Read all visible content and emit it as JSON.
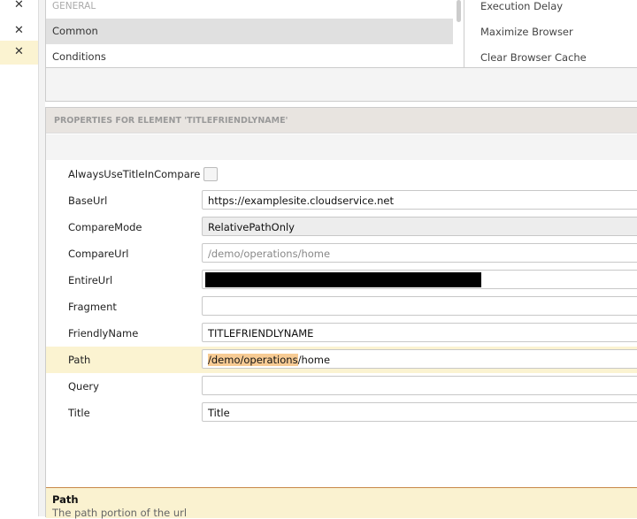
{
  "left_panel": {
    "rows": [
      {
        "icon": "close-icon",
        "selected": false
      },
      {
        "icon": "close-icon",
        "selected": false
      },
      {
        "icon": "close-icon",
        "selected": true
      }
    ]
  },
  "categories": {
    "header": "GENERAL",
    "items": [
      {
        "label": "Common",
        "selected": true
      },
      {
        "label": "Conditions",
        "selected": false
      }
    ]
  },
  "actions": [
    "Execution Delay",
    "Maximize Browser",
    "Clear Browser Cache"
  ],
  "properties": {
    "header": "PROPERTIES FOR ELEMENT 'TITLEFRIENDLYNAME'",
    "rows": [
      {
        "label": "AlwaysUseTitleInCompare",
        "type": "checkbox",
        "checked": false
      },
      {
        "label": "BaseUrl",
        "value": "https://examplesite.cloudservice.net"
      },
      {
        "label": "CompareMode",
        "value": "RelativePathOnly",
        "type": "combo"
      },
      {
        "label": "CompareUrl",
        "placeholder": "/demo/operations/home"
      },
      {
        "label": "EntireUrl",
        "value": "",
        "redacted": true
      },
      {
        "label": "Fragment",
        "value": ""
      },
      {
        "label": "FriendlyName",
        "value": "TITLEFRIENDLYNAME"
      },
      {
        "label": "Path",
        "value_highlight": "/demo/operations",
        "value_rest": "/home",
        "selected": true
      },
      {
        "label": "Query",
        "value": ""
      },
      {
        "label": "Title",
        "value": "Title"
      }
    ]
  },
  "help": {
    "title": "Path",
    "description": "The path portion of the url"
  },
  "colors": {
    "selected_row": "#fbf3d1",
    "highlight": "#f7cb94",
    "footer_border": "#c8894a"
  }
}
